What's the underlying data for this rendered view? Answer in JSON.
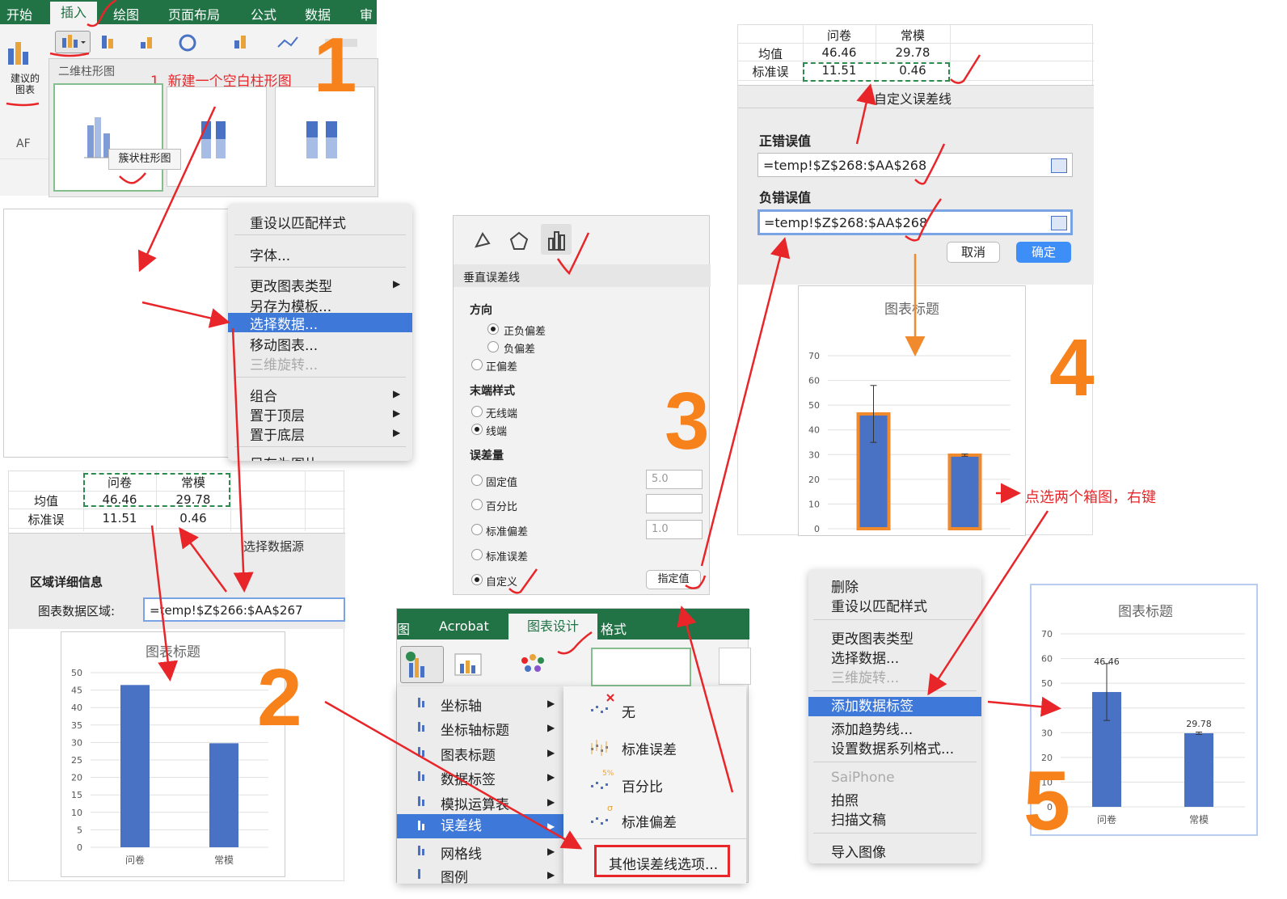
{
  "ribbon": {
    "tabs": [
      "开始",
      "插入",
      "绘图",
      "页面布局",
      "公式",
      "数据",
      "审"
    ],
    "recommended_chart": "建议的\n图表",
    "section_2d": "二维柱形图",
    "tooltip": "簇状柱形图",
    "cell_af": "AF",
    "step1_note": "1. 新建一个空白柱形图"
  },
  "context_menu_1": {
    "items": [
      {
        "label": "重设以匹配样式"
      },
      {
        "label": "字体..."
      },
      {
        "label": "更改图表类型"
      },
      {
        "label": "另存为模板..."
      },
      {
        "label": "选择数据..."
      },
      {
        "label": "移动图表..."
      },
      {
        "label": "三维旋转..."
      },
      {
        "label": "组合"
      },
      {
        "label": "置于顶层"
      },
      {
        "label": "置于底层"
      },
      {
        "label": "另存为图片"
      }
    ]
  },
  "sheet_table": {
    "headers": [
      "问卷",
      "常模"
    ],
    "rows": [
      {
        "label": "均值",
        "values": [
          "46.46",
          "29.78"
        ]
      },
      {
        "label": "标准误",
        "values": [
          "11.51",
          "0.46"
        ]
      }
    ]
  },
  "select_data_dialog": {
    "title": "选择数据源",
    "section": "区域详细信息",
    "range_label": "图表数据区域:",
    "range_value": "=temp!$Z$266:$AA$267"
  },
  "chart_step2": {
    "title": "图表标题"
  },
  "format_panel": {
    "section": "垂直误差线",
    "direction_label": "方向",
    "direction_options": [
      "正负偏差",
      "负偏差",
      "正偏差"
    ],
    "end_style_label": "末端样式",
    "end_style_options": [
      "无线端",
      "线端"
    ],
    "amount_label": "误差量",
    "amount_options": [
      "固定值",
      "百分比",
      "标准偏差",
      "标准误差",
      "自定义"
    ],
    "fixed_value": "5.0",
    "std_dev_value": "1.0",
    "specify_button": "指定值"
  },
  "chart_design_ribbon": {
    "tabs": [
      "图",
      "Acrobat",
      "图表设计",
      "格式"
    ],
    "menu_items": [
      "坐标轴",
      "坐标轴标题",
      "图表标题",
      "数据标签",
      "模拟运算表",
      "误差线",
      "网格线",
      "图例"
    ],
    "error_bar_items": [
      "无",
      "标准误差",
      "百分比",
      "标准偏差"
    ],
    "more_options": "其他误差线选项...",
    "percent_icon_text": "5%",
    "sigma_icon_text": "σ"
  },
  "custom_error_dialog": {
    "title": "自定义误差线",
    "positive_label": "正错误值",
    "positive_value": "=temp!$Z$268:$AA$268",
    "negative_label": "负错误值",
    "negative_value": "=temp!$Z$268:$AA$268",
    "cancel": "取消",
    "ok": "确定"
  },
  "chart_step4": {
    "title": "图表标题",
    "note": "点选两个箱图，右键"
  },
  "context_menu_2": {
    "items": [
      {
        "label": "删除"
      },
      {
        "label": "重设以匹配样式"
      },
      {
        "label": "更改图表类型"
      },
      {
        "label": "选择数据..."
      },
      {
        "label": "三维旋转..."
      },
      {
        "label": "添加数据标签"
      },
      {
        "label": "添加趋势线..."
      },
      {
        "label": "设置数据系列格式..."
      },
      {
        "label": "SaiPhone"
      },
      {
        "label": "拍照"
      },
      {
        "label": "扫描文稿"
      },
      {
        "label": "导入图像"
      }
    ]
  },
  "chart_step5": {
    "title": "图表标题"
  },
  "step_numbers": [
    "1",
    "2",
    "3",
    "4",
    "5"
  ],
  "colors": {
    "bar": "#4a72c4",
    "bar_outline": "#f08a2c",
    "annotation": "#e8262a",
    "step_number": "#f7821b",
    "selection": "#3e78d9"
  },
  "chart_data": [
    {
      "type": "bar",
      "title": "图表标题",
      "categories": [
        "问卷",
        "常模"
      ],
      "values": [
        46.46,
        29.78
      ],
      "ylim": [
        0,
        50
      ],
      "yticks": [
        0,
        5,
        10,
        15,
        20,
        25,
        30,
        35,
        40,
        45,
        50
      ],
      "grid": true
    },
    {
      "type": "bar",
      "title": "图表标题",
      "categories": [
        "问卷",
        "常模"
      ],
      "values": [
        46.46,
        29.78
      ],
      "error": [
        11.51,
        0.46
      ],
      "ylim": [
        0,
        70
      ],
      "yticks": [
        0,
        10,
        20,
        30,
        40,
        50,
        60,
        70
      ],
      "grid": true
    },
    {
      "type": "bar",
      "title": "图表标题",
      "categories": [
        "问卷",
        "常模"
      ],
      "values": [
        46.46,
        29.78
      ],
      "error": [
        11.51,
        0.46
      ],
      "data_labels": [
        "46.46",
        "29.78"
      ],
      "ylim": [
        0,
        70
      ],
      "yticks": [
        0,
        10,
        20,
        30,
        40,
        50,
        60,
        70
      ],
      "grid": true
    }
  ]
}
